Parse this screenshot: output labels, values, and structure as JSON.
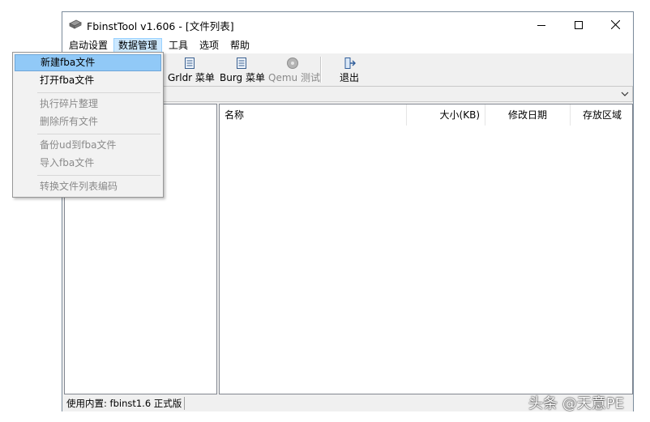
{
  "window": {
    "title": "FbinstTool v1.606 - [文件列表]",
    "controls": {
      "minimize": "minimize",
      "maximize": "maximize",
      "close": "close"
    }
  },
  "menubar": [
    {
      "label": "启动设置"
    },
    {
      "label": "数据管理",
      "active": true
    },
    {
      "label": "工具"
    },
    {
      "label": "选项"
    },
    {
      "label": "帮助"
    }
  ],
  "toolbar": {
    "grldr": {
      "label": "Grldr 菜单",
      "icon": "document-list-icon"
    },
    "burg": {
      "label": "Burg 菜单",
      "icon": "document-list-icon"
    },
    "qemu": {
      "label": "Qemu 测试",
      "icon": "disc-icon",
      "disabled": true
    },
    "exit": {
      "label": "退出",
      "icon": "exit-door-icon"
    }
  },
  "file_list": {
    "columns": [
      {
        "label": "名称"
      },
      {
        "label": "大小(KB)"
      },
      {
        "label": "修改日期"
      },
      {
        "label": "存放区域"
      }
    ],
    "rows": []
  },
  "statusbar": {
    "text": "使用内置: fbinst1.6 正式版"
  },
  "dropdown_menu": {
    "items": [
      {
        "label": "新建fba文件",
        "highlighted": true,
        "disabled": false
      },
      {
        "label": "打开fba文件",
        "disabled": false
      },
      {
        "label": "执行碎片整理",
        "disabled": true
      },
      {
        "label": "删除所有文件",
        "disabled": true
      },
      {
        "label": "备份ud到fba文件",
        "disabled": true
      },
      {
        "label": "导入fba文件",
        "disabled": true
      },
      {
        "label": "转换文件列表编码",
        "disabled": true
      }
    ]
  },
  "watermark": "头条 @天意PE",
  "colors": {
    "menu_highlight": "#91c9f7",
    "menubar_active": "#cce8ff",
    "window_bg": "#f0f0f0",
    "disabled_text": "#8a8a8a"
  }
}
